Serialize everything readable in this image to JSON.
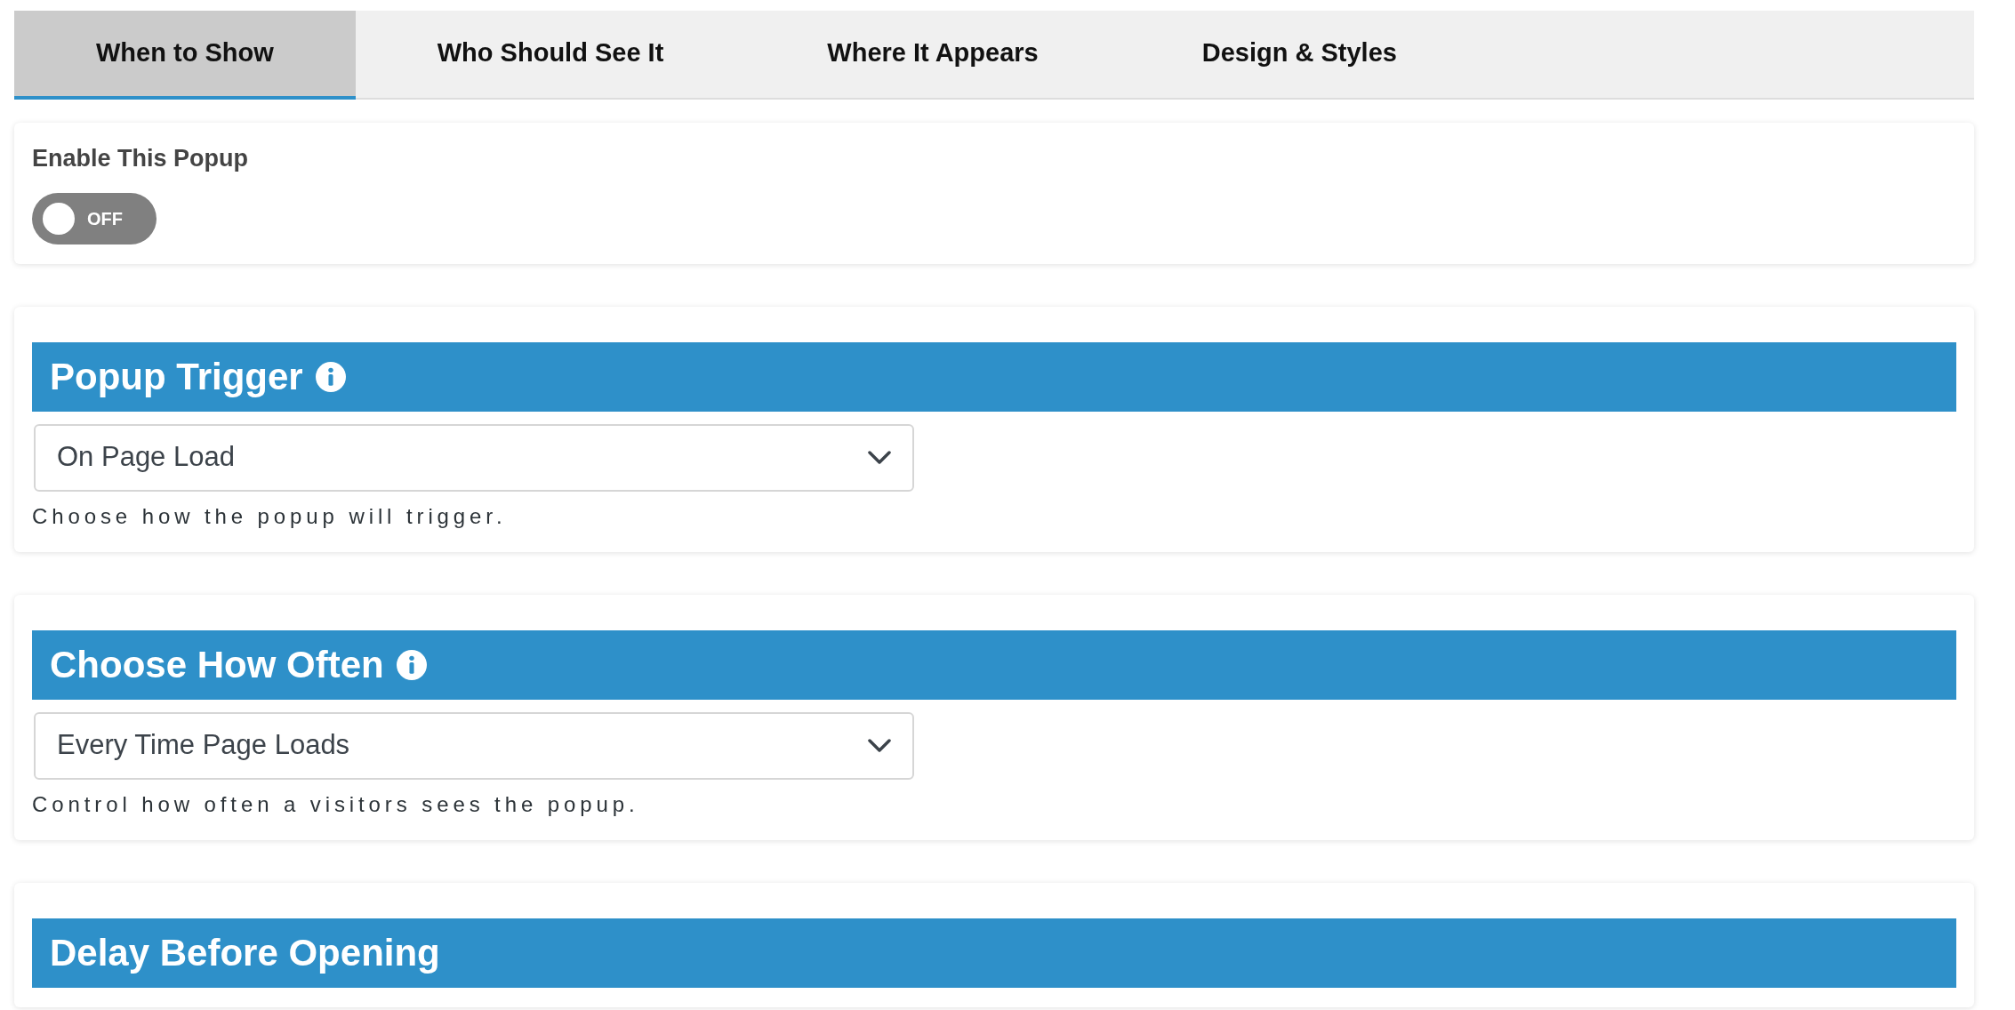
{
  "tabs": [
    {
      "label": "When to Show",
      "selected": true
    },
    {
      "label": "Who Should See It",
      "selected": false
    },
    {
      "label": "Where It Appears",
      "selected": false
    },
    {
      "label": "Design & Styles",
      "selected": false
    }
  ],
  "enable_popup": {
    "label": "Enable This Popup",
    "on": false,
    "state_text": "OFF"
  },
  "sections": [
    {
      "title": "Popup Trigger",
      "info_icon": true,
      "select_value": "On Page Load",
      "help": "Choose how the popup will trigger."
    },
    {
      "title": "Choose How Often",
      "info_icon": true,
      "select_value": "Every Time Page Loads",
      "help": "Control how often a visitors sees the popup."
    },
    {
      "title": "Delay Before Opening",
      "info_icon": false
    }
  ]
}
